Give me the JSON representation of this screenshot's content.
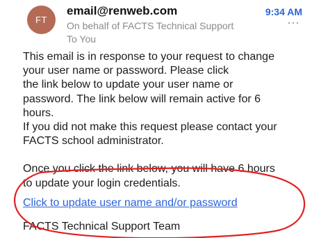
{
  "header": {
    "avatar_initials": "FT",
    "sender": "email@renweb.com",
    "time": "9:34 AM",
    "on_behalf": "On behalf of FACTS Technical Support",
    "to": "To You",
    "more_icon": "ellipsis-icon"
  },
  "body": {
    "lines": [
      "This email is in response to your request to change",
      "your user name or password. Please click",
      "the link below to update your user name or",
      "password. The link below will remain active for 6",
      "hours.",
      "If you did not make this request please contact your",
      "FACTS school administrator.",
      "Once you click the link below, you will have 6 hours",
      "to update your login credentials."
    ]
  },
  "link": {
    "text": "Click to update user name and/or password"
  },
  "signature": "FACTS Technical Support Team",
  "colors": {
    "accent": "#2b63d8",
    "avatar": "#b46a55",
    "annotation": "#e02020"
  }
}
